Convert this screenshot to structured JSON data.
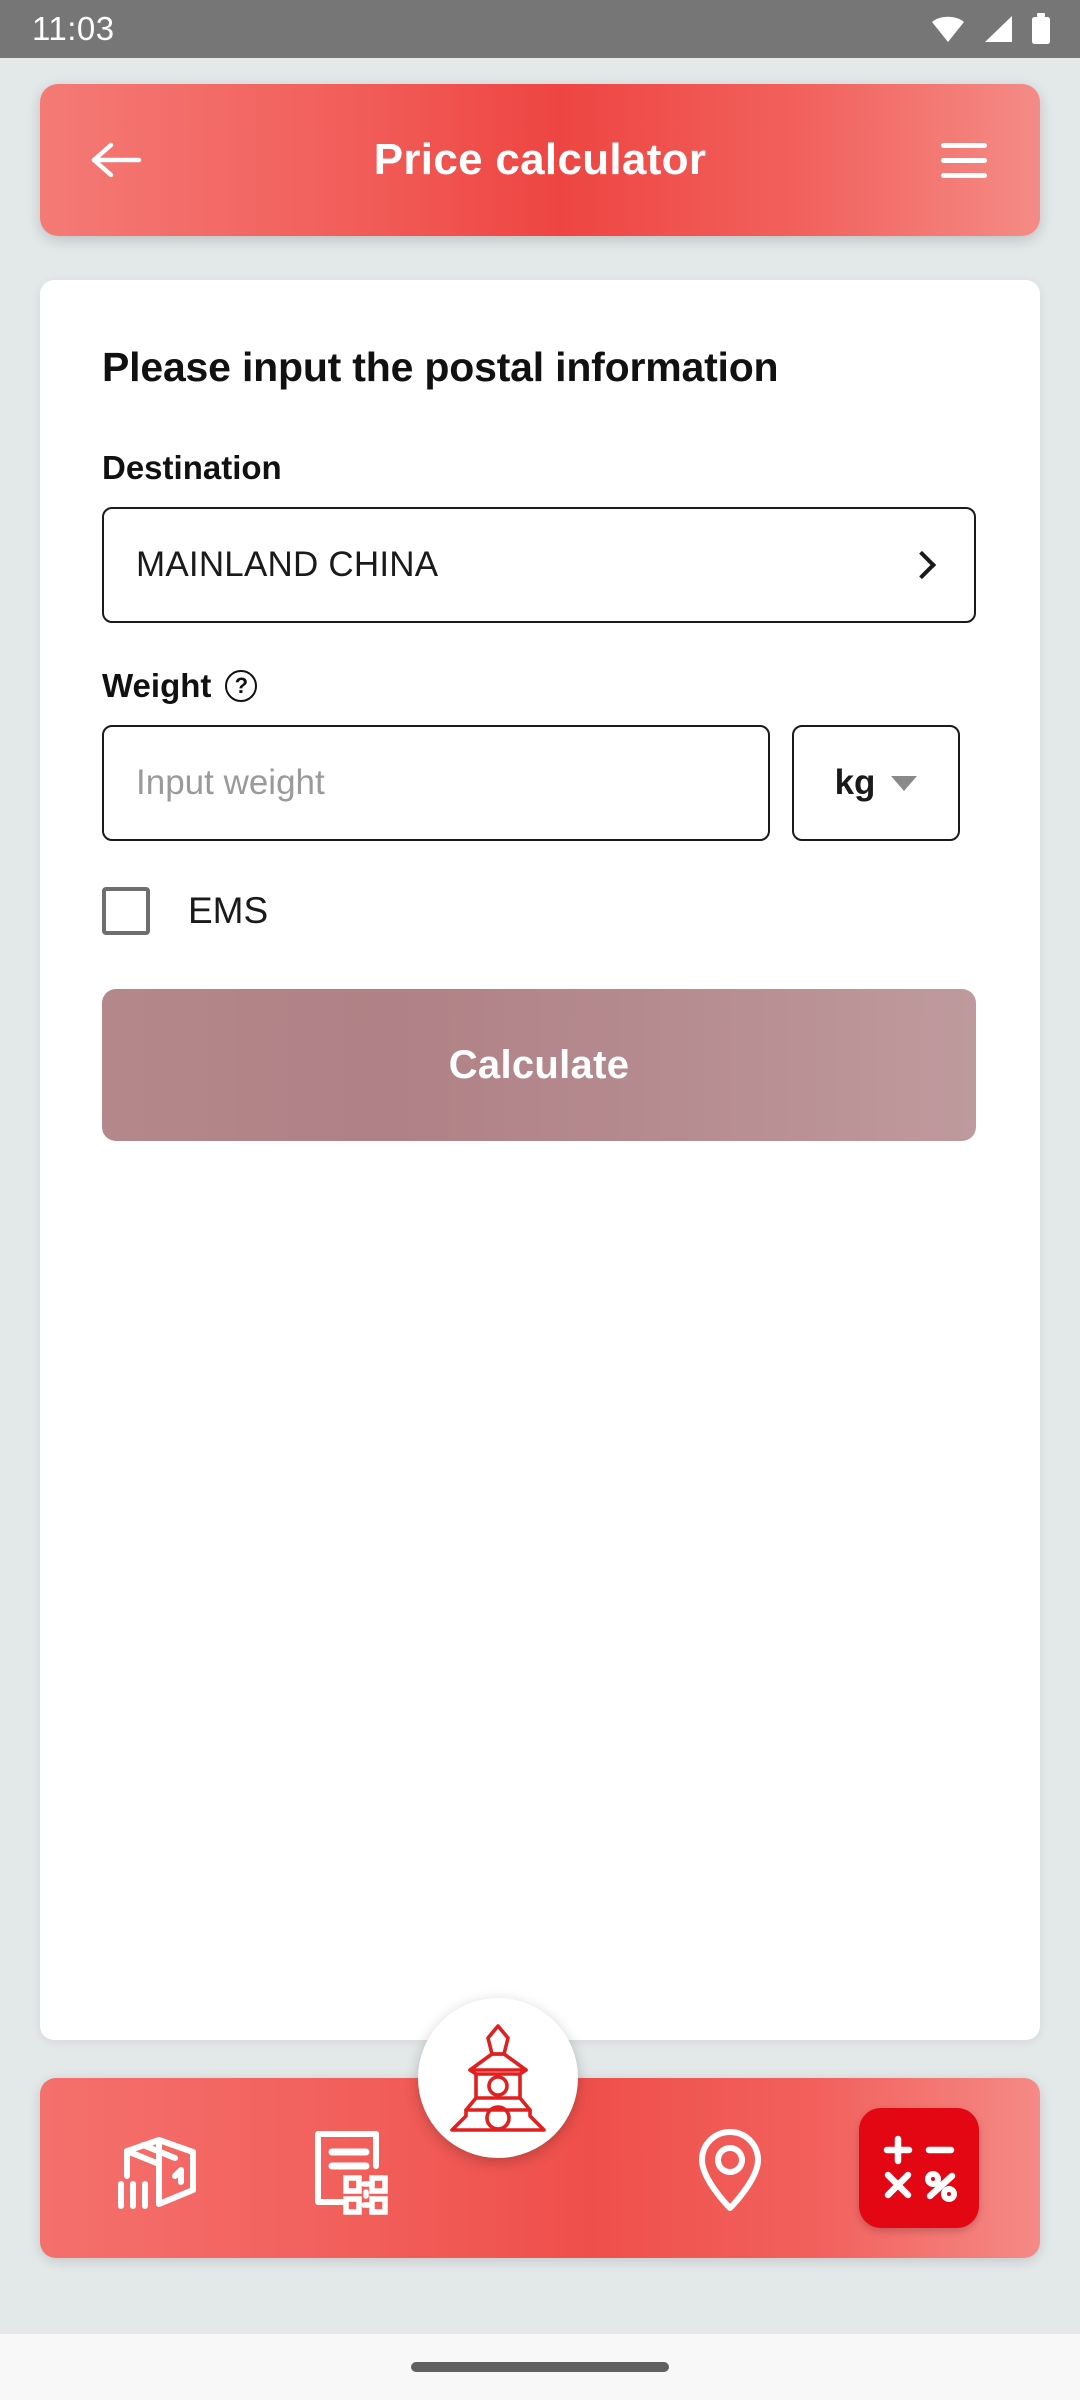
{
  "status_bar": {
    "clock": "11:03",
    "icons": [
      "wifi-icon",
      "cellular-signal-icon",
      "battery-icon"
    ],
    "background_color": "#767676"
  },
  "header": {
    "title": "Price calculator",
    "back_icon": "arrow-left-icon",
    "menu_icon": "hamburger-menu-icon",
    "accent_color": "#ee4542"
  },
  "form": {
    "heading": "Please input the postal information",
    "destination": {
      "label": "Destination",
      "value": "MAINLAND CHINA",
      "chevron_icon": "chevron-right-icon"
    },
    "weight": {
      "label": "Weight",
      "help_icon": "question-mark-icon",
      "help_glyph": "?",
      "placeholder": "Input weight",
      "value": "",
      "unit": "kg",
      "unit_caret_icon": "caret-down-icon"
    },
    "ems": {
      "label": "EMS",
      "checked": false
    },
    "submit": {
      "label": "Calculate",
      "enabled": false,
      "color": "#b4888b"
    }
  },
  "tab_bar": {
    "background_color": "#ef4f4b",
    "active_chip_color": "#e30613",
    "items": [
      {
        "name": "tab-track-parcel",
        "icon": "parcel-box-icon",
        "active": false
      },
      {
        "name": "tab-documents",
        "icon": "document-qrcode-icon",
        "active": false
      },
      {
        "name": "tab-home-logo",
        "icon": "pagoda-tower-logo-icon",
        "active": false
      },
      {
        "name": "tab-locations",
        "icon": "map-pin-icon",
        "active": false
      },
      {
        "name": "tab-calculator",
        "icon": "calculator-icon",
        "active": true
      }
    ],
    "calculator_glyphs": [
      "+",
      "−",
      "×",
      "%"
    ]
  },
  "system_nav": {
    "gesture_pill": "home-gesture-pill",
    "background_color": "#f8f8f8"
  },
  "page_background_color": "#e3e8e9"
}
